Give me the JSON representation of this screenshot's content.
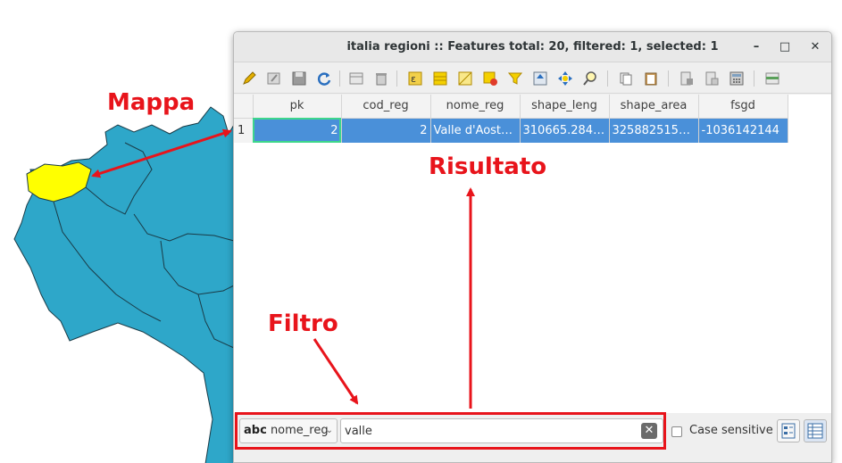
{
  "window": {
    "title": "italia regioni :: Features total: 20, filtered: 1, selected: 1",
    "minimize": "–",
    "maximize": "□",
    "close": "✕"
  },
  "toolbar": {
    "icons": [
      "pencil-icon",
      "edit-multiple-icon",
      "save-icon",
      "reload-icon",
      "new-feature-icon",
      "delete-icon",
      "select-expression-icon",
      "select-all-icon",
      "invert-selection-icon",
      "deselect-icon",
      "filter-icon",
      "move-selection-top-icon",
      "pan-to-selection-icon",
      "zoom-to-selection-icon",
      "copy-icon",
      "paste-icon",
      "delete-field-icon",
      "new-field-icon",
      "field-calculator-icon",
      "conditional-formatting-icon"
    ]
  },
  "table": {
    "columns": [
      "pk",
      "cod_reg",
      "nome_reg",
      "shape_leng",
      "shape_area",
      "fsgd"
    ],
    "rows": [
      {
        "index": "1",
        "cells": [
          "2",
          "2",
          "Valle d'Aost…",
          "310665.284…",
          "325882515…",
          "-1036142144"
        ]
      }
    ]
  },
  "filterbar": {
    "field_prefix": "abc",
    "field_name": "nome_reg",
    "filter_value": "valle",
    "case_sensitive_label": "Case sensitive",
    "case_sensitive_checked": false
  },
  "annotations": {
    "map_label": "Mappa",
    "result_label": "Risultato",
    "filter_label": "Filtro",
    "color": "#e8141b"
  },
  "colors": {
    "map_fill": "#2ea7c9",
    "selected_region": "#ffff00",
    "selection_row": "#4a90d9"
  }
}
